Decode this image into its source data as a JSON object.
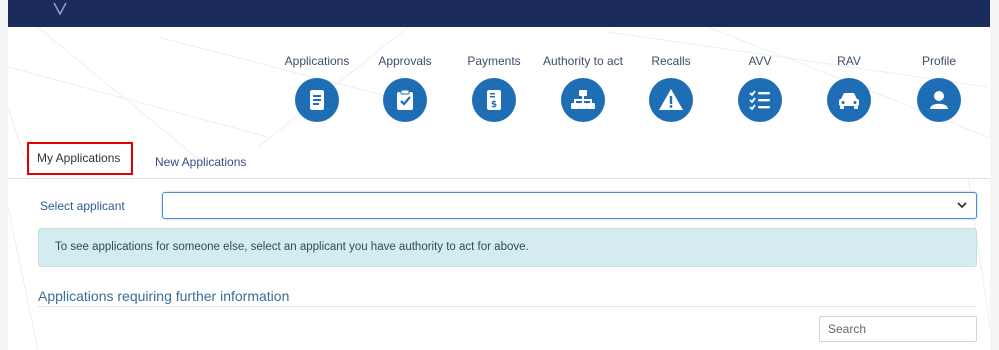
{
  "nav": {
    "items": [
      {
        "label": "Applications",
        "icon": "document-icon"
      },
      {
        "label": "Approvals",
        "icon": "clipboard-check-icon"
      },
      {
        "label": "Payments",
        "icon": "invoice-dollar-icon"
      },
      {
        "label": "Authority to act",
        "icon": "org-chart-icon"
      },
      {
        "label": "Recalls",
        "icon": "warning-triangle-icon"
      },
      {
        "label": "AVV",
        "icon": "checklist-icon"
      },
      {
        "label": "RAV",
        "icon": "car-icon"
      },
      {
        "label": "Profile",
        "icon": "user-icon"
      }
    ]
  },
  "tabs": {
    "my_applications": "My Applications",
    "new_applications": "New Applications"
  },
  "applicant": {
    "label": "Select applicant",
    "selected": ""
  },
  "info_message": "To see applications for someone else, select an applicant you have authority to act for above.",
  "section": {
    "title": "Applications requiring further information"
  },
  "search": {
    "placeholder": "Search"
  },
  "colors": {
    "topbar": "#1b2b5b",
    "icon_circle": "#1f6db5",
    "active_tab_highlight": "#e00000",
    "info_bg": "#d4ecf0"
  }
}
